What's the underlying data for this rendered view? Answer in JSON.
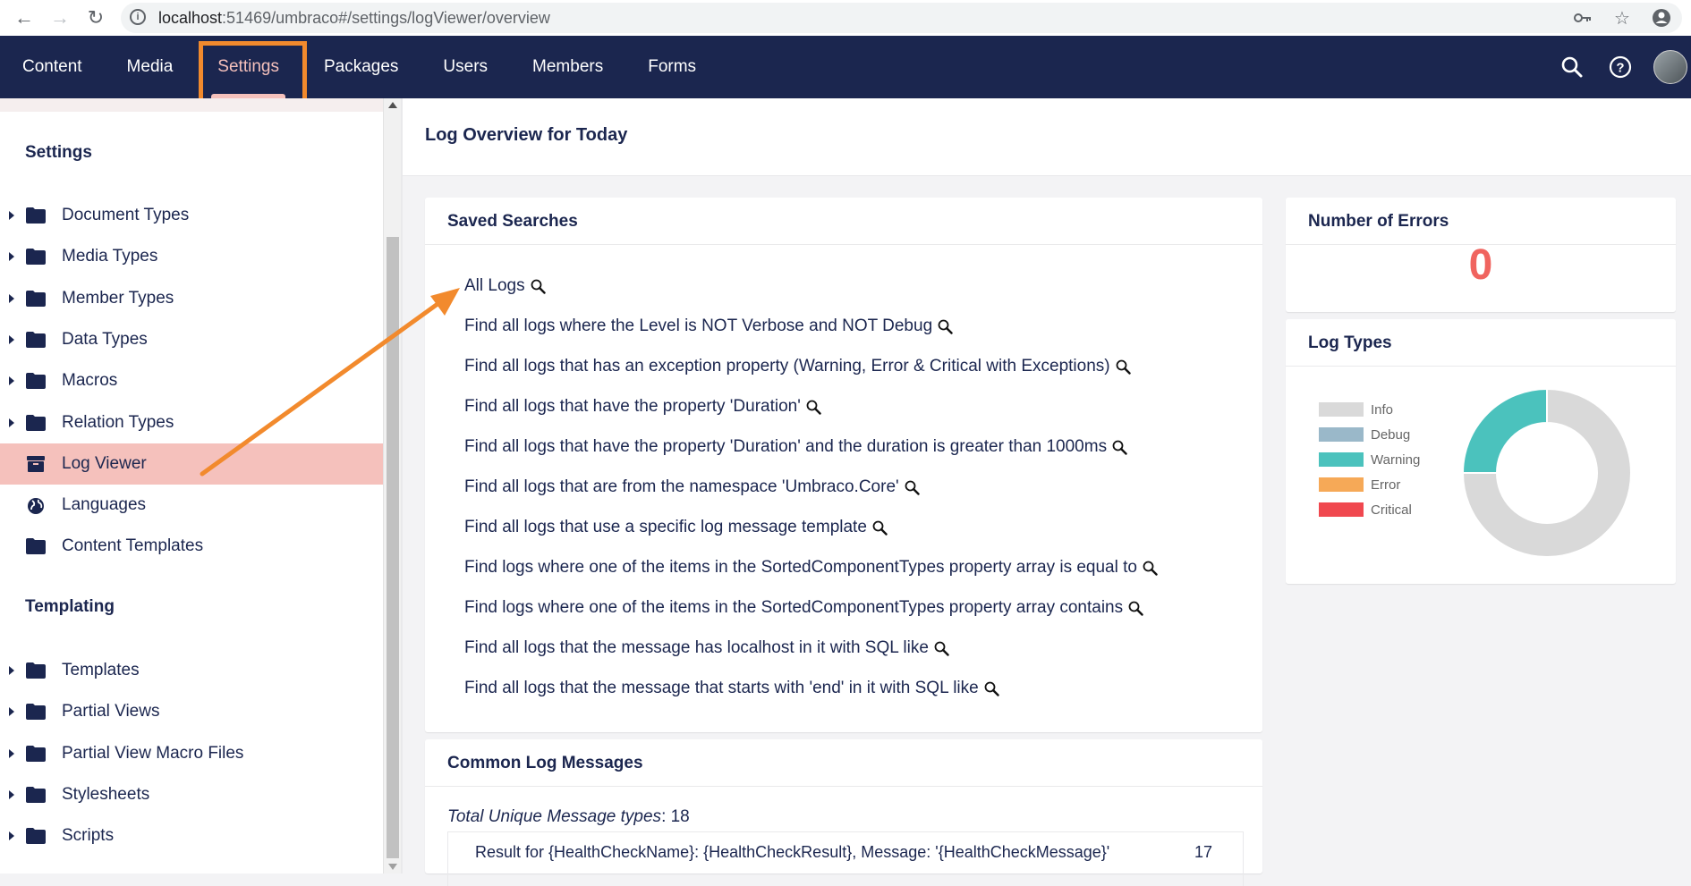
{
  "browser": {
    "url_host": "localhost",
    "url_rest": ":51469/umbraco#/settings/logViewer/overview"
  },
  "header": {
    "nav": [
      "Content",
      "Media",
      "Settings",
      "Packages",
      "Users",
      "Members",
      "Forms"
    ],
    "active": "Settings"
  },
  "sidebar": {
    "section1": "Settings",
    "items1": [
      {
        "label": "Document Types",
        "icon": "folder-icon",
        "caret": true
      },
      {
        "label": "Media Types",
        "icon": "folder-icon",
        "caret": true
      },
      {
        "label": "Member Types",
        "icon": "folder-icon",
        "caret": true
      },
      {
        "label": "Data Types",
        "icon": "folder-icon",
        "caret": true
      },
      {
        "label": "Macros",
        "icon": "folder-icon",
        "caret": true
      },
      {
        "label": "Relation Types",
        "icon": "folder-icon",
        "caret": true
      },
      {
        "label": "Log Viewer",
        "icon": "archive-icon",
        "caret": false,
        "active": true
      },
      {
        "label": "Languages",
        "icon": "globe-icon",
        "caret": false
      },
      {
        "label": "Content Templates",
        "icon": "folder-icon",
        "caret": false
      }
    ],
    "section2": "Templating",
    "items2": [
      {
        "label": "Templates",
        "icon": "folder-icon",
        "caret": true
      },
      {
        "label": "Partial Views",
        "icon": "folder-icon",
        "caret": true
      },
      {
        "label": "Partial View Macro Files",
        "icon": "folder-icon",
        "caret": true
      },
      {
        "label": "Stylesheets",
        "icon": "folder-icon",
        "caret": true
      },
      {
        "label": "Scripts",
        "icon": "folder-icon",
        "caret": true
      }
    ]
  },
  "main": {
    "title": "Log Overview for Today",
    "saved_searches": {
      "title": "Saved Searches",
      "items": [
        "All Logs",
        "Find all logs where the Level is NOT Verbose and NOT Debug",
        "Find all logs that has an exception property (Warning, Error & Critical with Exceptions)",
        "Find all logs that have the property 'Duration'",
        "Find all logs that have the property 'Duration' and the duration is greater than 1000ms",
        "Find all logs that are from the namespace 'Umbraco.Core'",
        "Find all logs that use a specific log message template",
        "Find logs where one of the items in the SortedComponentTypes property array is equal to",
        "Find logs where one of the items in the SortedComponentTypes property array contains",
        "Find all logs that the message has localhost in it with SQL like",
        "Find all logs that the message that starts with 'end' in it with SQL like"
      ]
    },
    "errors": {
      "title": "Number of Errors",
      "count": "0"
    },
    "log_types": {
      "title": "Log Types",
      "legend": [
        {
          "label": "Info",
          "color": "#d9d9d9"
        },
        {
          "label": "Debug",
          "color": "#9ab8c9"
        },
        {
          "label": "Warning",
          "color": "#4bc2bd"
        },
        {
          "label": "Error",
          "color": "#f6a957"
        },
        {
          "label": "Critical",
          "color": "#f0484f"
        }
      ]
    },
    "common": {
      "title": "Common Log Messages",
      "total_label": "Total Unique Message types",
      "total_value": ": 18",
      "rows": [
        {
          "message": "Result for {HealthCheckName}: {HealthCheckResult}, Message: '{HealthCheckMessage}'",
          "count": "17"
        }
      ]
    }
  },
  "chart_data": {
    "type": "pie",
    "categories": [
      "Info",
      "Debug",
      "Warning",
      "Error",
      "Critical"
    ],
    "values": [
      75,
      0,
      25,
      0,
      0
    ],
    "colors": [
      "#d9d9d9",
      "#9ab8c9",
      "#4bc2bd",
      "#f6a957",
      "#f0484f"
    ],
    "legend_position": "left"
  }
}
